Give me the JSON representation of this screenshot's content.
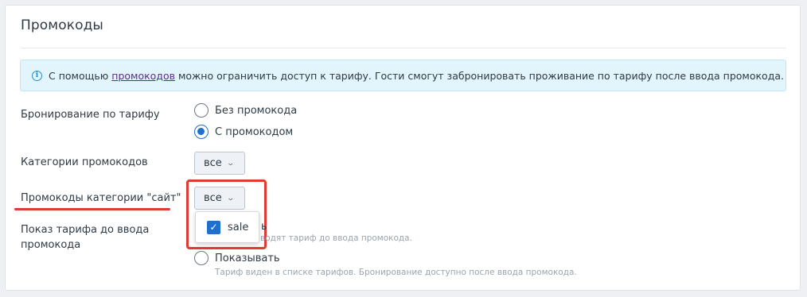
{
  "section": {
    "title": "Промокоды"
  },
  "info": {
    "text_before": "С помощью",
    "link": "промокодов",
    "text_after": "можно ограничить доступ к тарифу. Гости смогут забронировать проживание по тарифу после ввода промокода."
  },
  "booking": {
    "label": "Бронирование по тарифу",
    "options": [
      {
        "label": "Без промокода",
        "checked": false
      },
      {
        "label": "С промокодом",
        "checked": true
      }
    ]
  },
  "categories": {
    "label": "Категории промокодов",
    "value": "все"
  },
  "site_codes": {
    "label": "Промокоды категории \"сайт\"",
    "value": "все",
    "menu_items": [
      {
        "label": "sale",
        "checked": true
      }
    ]
  },
  "show_tariff": {
    "label_line1": "Показ тарифа до ввода",
    "label_line2": "промокода",
    "hidden_option_fragment": "ь",
    "hidden_hint_fragment": "водят тариф до ввода промокода.",
    "show_label": "Показывать",
    "show_hint": "Тариф виден в списке тарифов. Бронирование доступно после ввода промокода."
  },
  "colors": {
    "accent": "#1e6fd0",
    "highlight": "#e03a35",
    "info_bg": "#e3f5fc"
  }
}
